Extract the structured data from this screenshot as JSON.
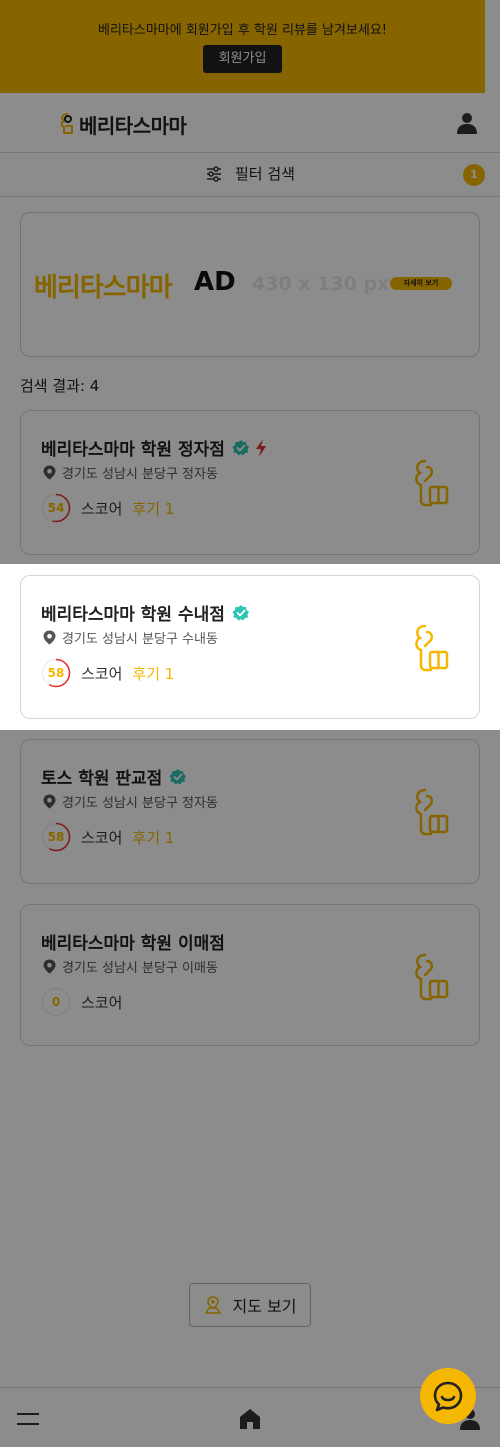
{
  "banner": {
    "text": "베리타스마마에 회원가입 후 학원 리뷰를 남겨보세요!",
    "button_label": "회원가입"
  },
  "header": {
    "logo_text": "베리타스마마"
  },
  "filter": {
    "label": "필터 검색",
    "count": "1"
  },
  "ad": {
    "brand": "베리타스마마",
    "tag": "AD",
    "size": "430 x 130 px",
    "more_label": "자세히 보기"
  },
  "results": {
    "label": "검색 결과: 4"
  },
  "academies": [
    {
      "name": "베리타스마마 학원 정자점",
      "address": "경기도 성남시 분당구 정자동",
      "score": "54",
      "score_value": 54,
      "score_label": "스코어",
      "review_label": "후기 1",
      "verified": true,
      "featured": true
    },
    {
      "name": "베리타스마마 학원 수내점",
      "address": "경기도 성남시 분당구 수내동",
      "score": "58",
      "score_value": 58,
      "score_label": "스코어",
      "review_label": "후기 1",
      "verified": true,
      "featured": false
    },
    {
      "name": "토스 학원 판교점",
      "address": "경기도 성남시 분당구 정자동",
      "score": "58",
      "score_value": 58,
      "score_label": "스코어",
      "review_label": "후기 1",
      "verified": true,
      "featured": false
    },
    {
      "name": "베리타스마마 학원 이매점",
      "address": "경기도 성남시 분당구 이매동",
      "score": "0",
      "score_value": 0,
      "score_label": "스코어",
      "review_label": "",
      "verified": false,
      "featured": false
    }
  ],
  "map_button": {
    "label": "지도 보기"
  },
  "colors": {
    "accent": "#f5b700",
    "verified": "#2ec4b6",
    "bolt": "#e5302c",
    "score_ring": "#e5302c",
    "dark": "#222222"
  },
  "icons": {
    "logo": "veritas-logo-icon",
    "user": "user-icon",
    "filter": "sliders-icon",
    "verified": "verified-check-icon",
    "featured": "lightning-icon",
    "pin": "location-pin-icon",
    "academy": "academy-logo-icon",
    "map": "map-pin-icon",
    "menu": "hamburger-menu-icon",
    "home": "home-icon",
    "chat": "chat-icon"
  }
}
